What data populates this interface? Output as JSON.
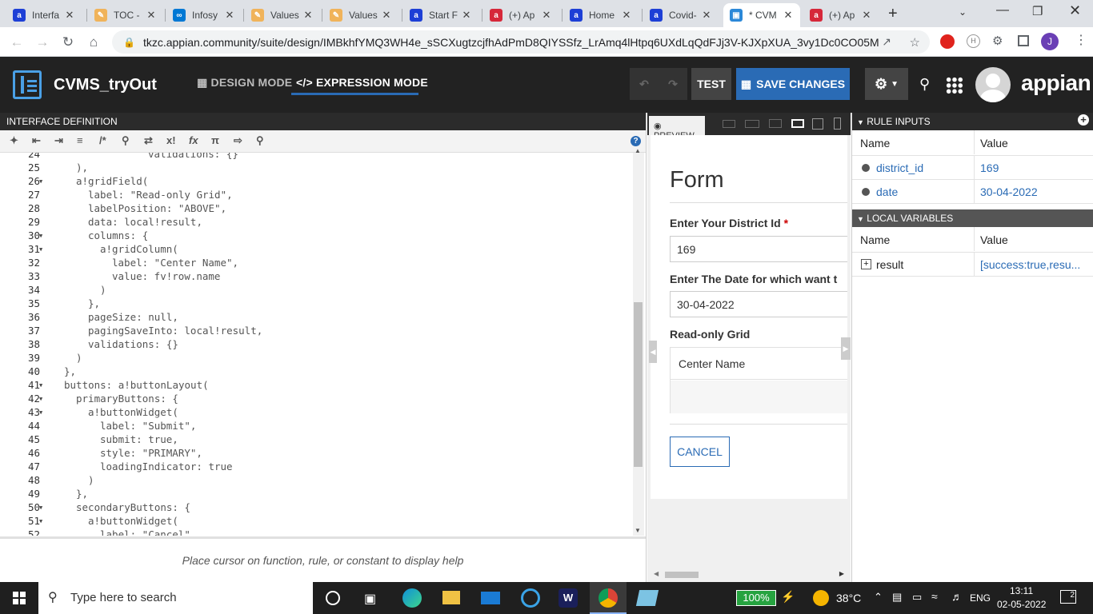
{
  "browser": {
    "tabs": [
      {
        "title": "Interfa",
        "icon_color": "#1d3fd6",
        "icon": "a"
      },
      {
        "title": "TOC -",
        "icon_color": "#f0b35a",
        "icon": "✎"
      },
      {
        "title": "Infosy",
        "icon_color": "#0078d4",
        "icon": "∞"
      },
      {
        "title": "Values",
        "icon_color": "#f0b35a",
        "icon": "✎"
      },
      {
        "title": "Values",
        "icon_color": "#f0b35a",
        "icon": "✎"
      },
      {
        "title": "Start F",
        "icon_color": "#1d3fd6",
        "icon": "a"
      },
      {
        "title": "(+) Ap",
        "icon_color": "#d6283a",
        "icon": "a"
      },
      {
        "title": "Home",
        "icon_color": "#1d3fd6",
        "icon": "a"
      },
      {
        "title": "Covid-",
        "icon_color": "#1d3fd6",
        "icon": "a"
      },
      {
        "title": "* CVM",
        "icon_color": "#2b88d8",
        "icon": "▣"
      },
      {
        "title": "(+) Ap",
        "icon_color": "#d6283a",
        "icon": "a"
      }
    ],
    "new_tab": "+",
    "url": "tkzc.appian.community/suite/design/IMBkhfYMQ3WH4e_sSCXugtzcjfhAdPmD8QIYSSfz_LrAmq4lHtpq6UXdLqQdFJj3V-KJXpXUA_3vy1Dc0CO05Mbx...",
    "profile_initial": "J"
  },
  "app": {
    "title": "CVMS_tryOut",
    "design_mode": "DESIGN MODE",
    "expression_mode": "EXPRESSION MODE",
    "test_label": "TEST",
    "save_label": "SAVE CHANGES",
    "brand": "appian",
    "accent": "#2a6bb5"
  },
  "editor": {
    "panel_title": "INTERFACE DEFINITION",
    "help_text": "Place cursor on function, rule, or constant to display help",
    "lines": [
      {
        "n": "24",
        "t": "validations: {}"
      },
      {
        "n": "25",
        "t": "),"
      },
      {
        "n": "26",
        "t": "a!gridField("
      },
      {
        "n": "27",
        "t": "label: \"Read-only Grid\","
      },
      {
        "n": "28",
        "t": "labelPosition: \"ABOVE\","
      },
      {
        "n": "29",
        "t": "data: local!result,"
      },
      {
        "n": "30",
        "t": "columns: {"
      },
      {
        "n": "31",
        "t": "a!gridColumn("
      },
      {
        "n": "32",
        "t": "label: \"Center Name\","
      },
      {
        "n": "33",
        "t": "value: fv!row.name"
      },
      {
        "n": "34",
        "t": ")"
      },
      {
        "n": "35",
        "t": "},"
      },
      {
        "n": "36",
        "t": "pageSize: null,"
      },
      {
        "n": "37",
        "t": "pagingSaveInto: local!result,"
      },
      {
        "n": "38",
        "t": "validations: {}"
      },
      {
        "n": "39",
        "t": ")"
      },
      {
        "n": "40",
        "t": "},"
      },
      {
        "n": "41",
        "t": "buttons: a!buttonLayout("
      },
      {
        "n": "42",
        "t": "primaryButtons: {"
      },
      {
        "n": "43",
        "t": "a!buttonWidget("
      },
      {
        "n": "44",
        "t": "label: \"Submit\","
      },
      {
        "n": "45",
        "t": "submit: true,"
      },
      {
        "n": "46",
        "t": "style: \"PRIMARY\","
      },
      {
        "n": "47",
        "t": "loadingIndicator: true"
      },
      {
        "n": "48",
        "t": ")"
      },
      {
        "n": "49",
        "t": "},"
      },
      {
        "n": "50",
        "t": "secondaryButtons: {"
      },
      {
        "n": "51",
        "t": "a!buttonWidget("
      },
      {
        "n": "52",
        "t": "label: \"Cancel\","
      }
    ]
  },
  "preview": {
    "tab_label": "PREVIEW",
    "form_title": "Form",
    "field1_label": "Enter Your District Id",
    "required_mark": "*",
    "field1_value": "169",
    "field2_label": "Enter The Date for which want t",
    "field2_value": "30-04-2022",
    "grid_label": "Read-only Grid",
    "grid_col": "Center Name",
    "cancel_label": "CANCEL"
  },
  "rule_inputs": {
    "title": "RULE INPUTS",
    "col_name": "Name",
    "col_value": "Value",
    "rows": [
      {
        "name": "district_id",
        "value": "169"
      },
      {
        "name": "date",
        "value": "30-04-2022"
      }
    ]
  },
  "local_vars": {
    "title": "LOCAL VARIABLES",
    "col_name": "Name",
    "col_value": "Value",
    "rows": [
      {
        "name": "result",
        "value": "[success:true,resu..."
      }
    ]
  },
  "taskbar": {
    "search_placeholder": "Type here to search",
    "battery": "100%",
    "temp": "38°C",
    "lang": "ENG",
    "time": "13:11",
    "date": "02-05-2022",
    "notifications": "2"
  }
}
